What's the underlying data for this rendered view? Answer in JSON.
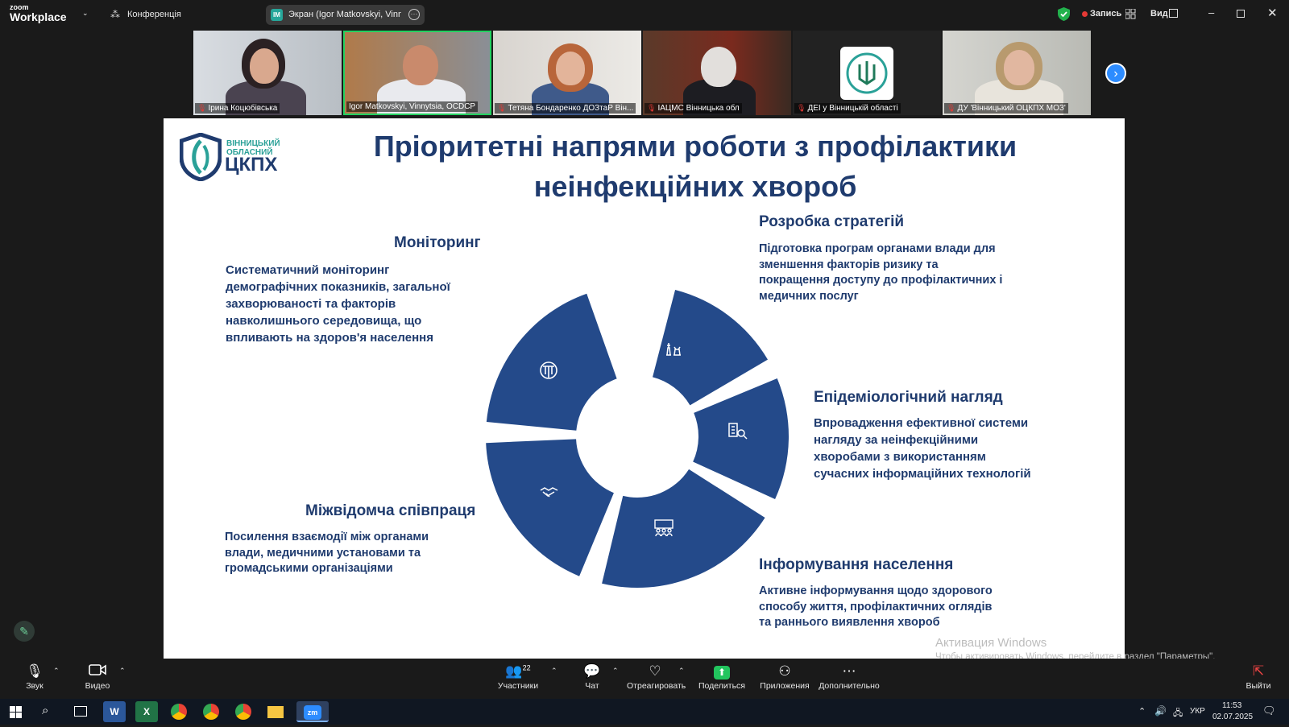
{
  "app": {
    "brand_small": "zoom",
    "brand_big": "Workplace",
    "conference_label": "Конференція",
    "share_badge": "IM",
    "share_label": "Экран (Igor Matkovskyi, Vinnytsi",
    "record_label": "Запись",
    "view_label": "Вид"
  },
  "participants": [
    {
      "name": "Ірина Коцюбівська"
    },
    {
      "name": "Igor Matkovskyi, Vinnytsia, OCDCP"
    },
    {
      "name": "Тетяна Бондаренко ДОЗтаР Він..."
    },
    {
      "name": "ІАЦМС Вінницька обл"
    },
    {
      "name": "ДЕІ у Вінницькій області"
    },
    {
      "name": "ДУ 'Вінницький ОЦКПХ МОЗ'"
    }
  ],
  "slide": {
    "logo_line1": "ВІННИЦЬКИЙ",
    "logo_line2": "ОБЛАСНИЙ",
    "logo_main": "ЦКПХ",
    "title_line1": "Пріоритетні напрями роботи  з профілактики",
    "title_line2": "неінфекційних хвороб",
    "sections": {
      "monitoring": {
        "heading": "Моніторинг",
        "lines": [
          "Систематичний моніторинг",
          "демографічних показників, загальної",
          "захворюваності та факторів",
          "навколишнього середовища, що",
          "впливають на здоров'я населення"
        ]
      },
      "strategy": {
        "heading": "Розробка стратегій",
        "lines": [
          "Підготовка програм органами влади для",
          "зменшення факторів ризику та",
          "покращення доступу до профілактичних і",
          "медичних послуг"
        ]
      },
      "epidem": {
        "heading": "Епідеміологічний нагляд",
        "lines": [
          "Впровадження ефективної системи",
          "нагляду за неінфекційними",
          "хворобами з використанням",
          "сучасних інформаційних технологій"
        ]
      },
      "informing": {
        "heading": "Інформування населення",
        "lines": [
          "Активне інформування щодо здорового",
          "способу життя, профілактичних оглядів",
          "та раннього виявлення хвороб"
        ]
      },
      "cooperation": {
        "heading": "Міжвідомча співпраця",
        "lines": [
          "Посилення взаємодії між органами",
          "влади, медичними установами та",
          "громадськими організаціями"
        ]
      }
    },
    "ring_color": "#244a8a"
  },
  "watermark": {
    "line1": "Активация Windows",
    "line2": "Чтобы активировать Windows, перейдите в раздел \"Параметры\"."
  },
  "toolbar": {
    "audio": "Звук",
    "video": "Видео",
    "participants": "Участники",
    "participants_count": "22",
    "chat": "Чат",
    "react": "Отреагировать",
    "share": "Поделиться",
    "apps": "Приложения",
    "more": "Дополнительно",
    "leave": "Выйти"
  },
  "taskbar": {
    "lang": "УКР",
    "time": "11:53",
    "date": "02.07.2025",
    "zoom_app": "zm"
  }
}
